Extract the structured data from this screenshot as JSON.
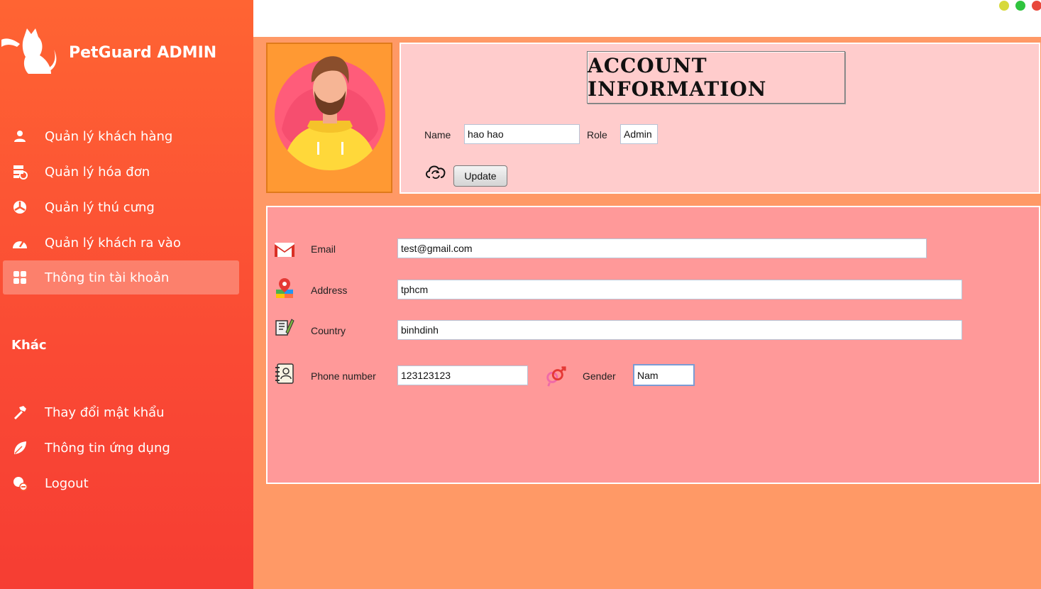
{
  "app": {
    "title": "PetGuard ADMIN"
  },
  "window_controls": [
    {
      "name": "minimize",
      "color": "#d7d93a"
    },
    {
      "name": "maximize",
      "color": "#2fc43e"
    },
    {
      "name": "close",
      "color": "#e8483b"
    }
  ],
  "sidebar": {
    "items": [
      {
        "label": "Quản lý khách hàng",
        "icon": "user-icon"
      },
      {
        "label": "Quản lý hóa đơn",
        "icon": "invoice-icon"
      },
      {
        "label": "Quản lý thú cưng",
        "icon": "pet-icon"
      },
      {
        "label": "Quản lý khách ra vào",
        "icon": "speedometer-icon"
      },
      {
        "label": "Thông tin tài khoản",
        "icon": "grid-icon",
        "active": true
      }
    ],
    "section_other": "Khác",
    "other_items": [
      {
        "label": "Thay đổi mật khẩu",
        "icon": "hammer-icon"
      },
      {
        "label": "Thông tin ứng dụng",
        "icon": "leaf-icon"
      },
      {
        "label": "Logout",
        "icon": "logout-icon"
      }
    ]
  },
  "account": {
    "title": "ACCOUNT INFORMATION",
    "name_label": "Name",
    "name_value": "hao hao",
    "role_label": "Role",
    "role_value": "Admin",
    "update_label": "Update"
  },
  "details": {
    "email_label": "Email",
    "email_value": "test@gmail.com",
    "address_label": "Address",
    "address_value": "tphcm",
    "country_label": "Country",
    "country_value": "binhdinh",
    "phone_label": "Phone number",
    "phone_value": "123123123",
    "gender_label": "Gender",
    "gender_value": "Nam"
  },
  "colors": {
    "sidebar_top": "#ff6433",
    "sidebar_bottom": "#f63d33",
    "content_bg": "#ff9966",
    "account_panel": "#ffcccc",
    "detail_panel": "#ff9999",
    "avatar_panel": "#ff9933"
  }
}
